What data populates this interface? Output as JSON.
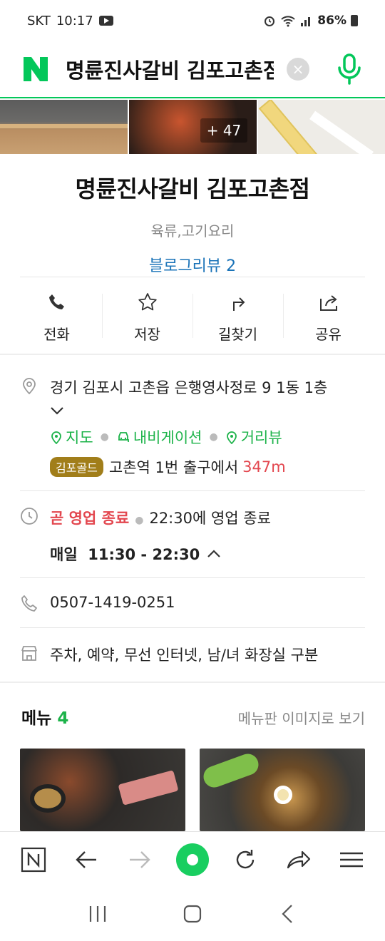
{
  "status_bar": {
    "carrier": "SKT",
    "time": "10:17",
    "battery": "86%"
  },
  "search": {
    "query": "명륜진사갈비 김포고촌점",
    "clear_label": "×"
  },
  "photos": {
    "more_count": "+ 47"
  },
  "place": {
    "title": "명륜진사갈비 김포고촌점",
    "category": "육류,고기요리",
    "blog_review": "블로그리뷰 2"
  },
  "actions": [
    {
      "label": "전화",
      "icon": "phone-icon"
    },
    {
      "label": "저장",
      "icon": "star-icon"
    },
    {
      "label": "길찾기",
      "icon": "directions-icon"
    },
    {
      "label": "공유",
      "icon": "share-icon"
    }
  ],
  "address": {
    "text": "경기 김포시 고촌읍 은행영사정로 9 1동 1층",
    "links": [
      "지도",
      "내비게이션",
      "거리뷰"
    ],
    "subway_line": "김포골드",
    "subway_text": "고촌역 1번 출구에서",
    "distance": "347m"
  },
  "hours": {
    "status": "곧 영업 종료",
    "closing": "22:30에 영업 종료",
    "detail": "매일  11:30 - 22:30"
  },
  "phone": "0507-1419-0251",
  "amenities": "주차, 예약, 무선 인터넷, 남/녀 화장실 구분",
  "menu": {
    "title": "메뉴",
    "count": "4",
    "view_link": "메뉴판 이미지로 보기"
  },
  "colors": {
    "naver_green": "#03c75a",
    "link_blue": "#1a73b8",
    "alert_red": "#e3474f",
    "line_gold": "#a17e1a"
  }
}
